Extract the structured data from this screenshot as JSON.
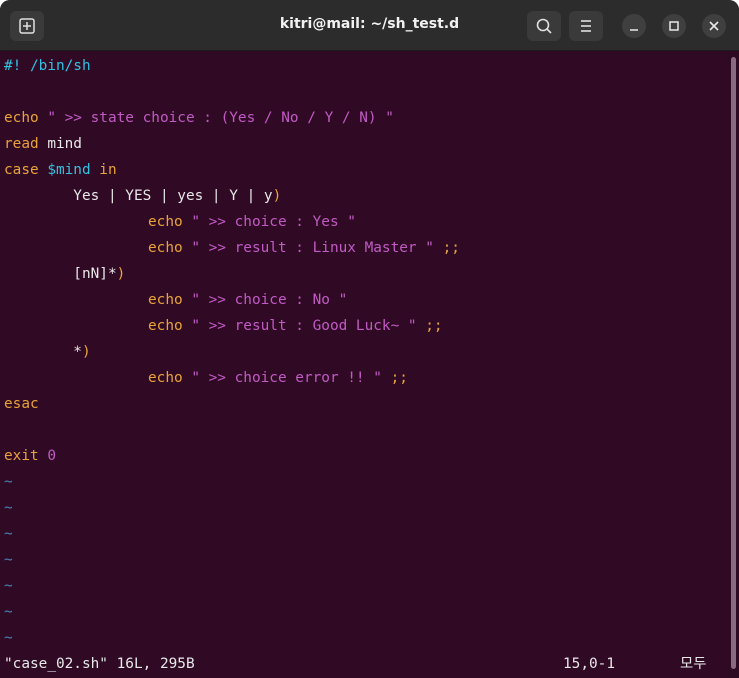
{
  "window": {
    "title": "kitri@mail: ~/sh_test.d"
  },
  "icons": {
    "new_tab": "new-tab-icon",
    "search": "search-icon",
    "menu": "hamburger-menu-icon",
    "minimize": "minimize-icon",
    "maximize": "maximize-icon",
    "close": "close-icon"
  },
  "colors": {
    "terminal_bg": "#300a24",
    "keyword": "#e8a33b",
    "string": "#c15ac5",
    "comment": "#34c0e0",
    "tilde": "#4a7fb8"
  },
  "code": {
    "l1": "#! /bin/sh",
    "l3_kw": "echo",
    "l3_str": " \" >> state choice : (Yes / No / Y / N) \"",
    "l4_kw": "read",
    "l4_rest": " mind",
    "l5_kw": "case",
    "l5_var": " $mind",
    "l5_in": " in",
    "l6_pattern": "        Yes | YES | yes | Y | y",
    "l6_paren": ")",
    "l7_kw": "echo",
    "l7_str": " \" >> choice : Yes \"",
    "l8_kw": "echo",
    "l8_str": " \" >> result : Linux Master \"",
    "l8_end": " ;;",
    "l9_pattern": "        [nN]*",
    "l9_paren": ")",
    "l10_kw": "echo",
    "l10_str": " \" >> choice : No \"",
    "l11_kw": "echo",
    "l11_str": " \" >> result : Good Luck~ \"",
    "l11_end": " ;;",
    "l12_pattern": "        *",
    "l12_paren": ")",
    "l13_kw": "echo",
    "l13_str": " \" >> choice error !! \"",
    "l13_end": " ;;",
    "l14_kw": "esac",
    "l16_kw": "exit",
    "l16_num": " 0",
    "tilde": "~"
  },
  "status": {
    "file_info": "\"case_02.sh\" 16L, 295B",
    "position": "15,0-1",
    "scroll": "모두"
  }
}
